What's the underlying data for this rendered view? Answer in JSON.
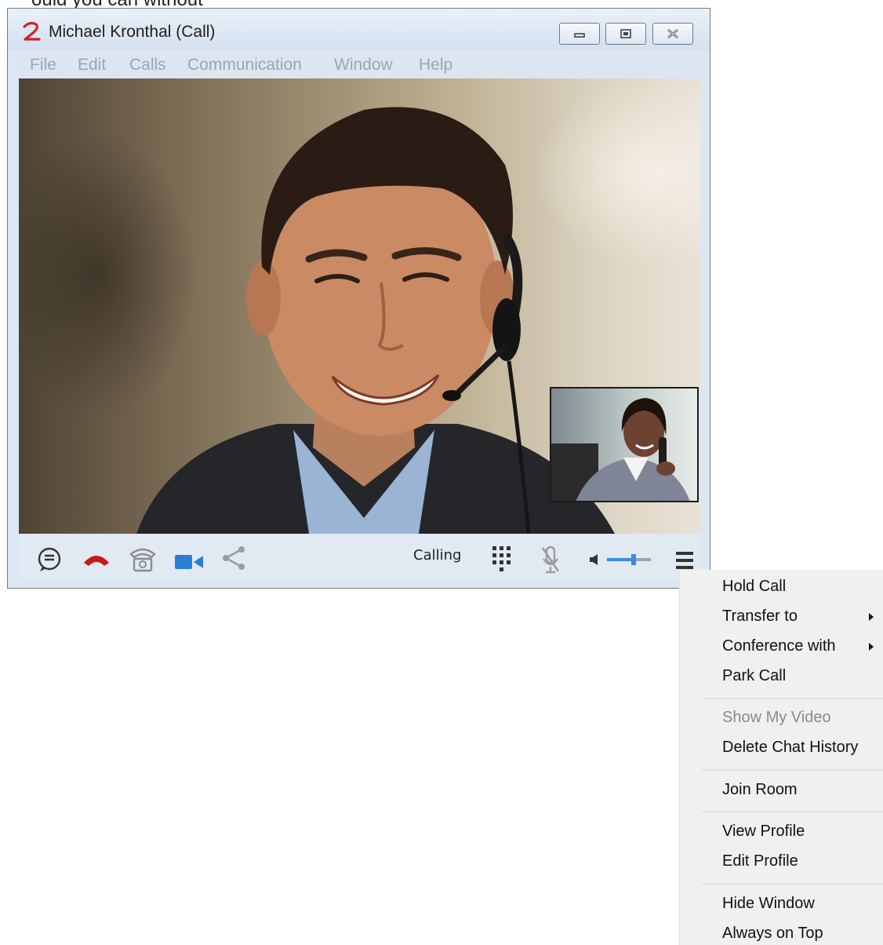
{
  "top_caption": "ould you can without",
  "window": {
    "title": "Michael Kronthal (Call)",
    "menu": [
      "File",
      "Edit",
      "Calls",
      "Communication",
      "Window",
      "Help"
    ]
  },
  "toolbar": {
    "status": "Calling",
    "volume_level": 0.6
  },
  "context_menu": {
    "items": [
      {
        "label": "Hold Call"
      },
      {
        "label": "Transfer to"
      },
      {
        "label": "Conference with"
      },
      {
        "label": "Park Call"
      },
      {
        "label": "Show My Video"
      },
      {
        "label": "Delete Chat History"
      },
      {
        "label": "Join Room"
      },
      {
        "label": "View Profile"
      },
      {
        "label": "Edit Profile"
      },
      {
        "label": "Hide Window"
      },
      {
        "label": "Always on Top"
      }
    ]
  },
  "colors": {
    "hangup": "#c81a1a",
    "video_icon": "#2a7fd4",
    "volume_slider": "#3b8be0"
  }
}
